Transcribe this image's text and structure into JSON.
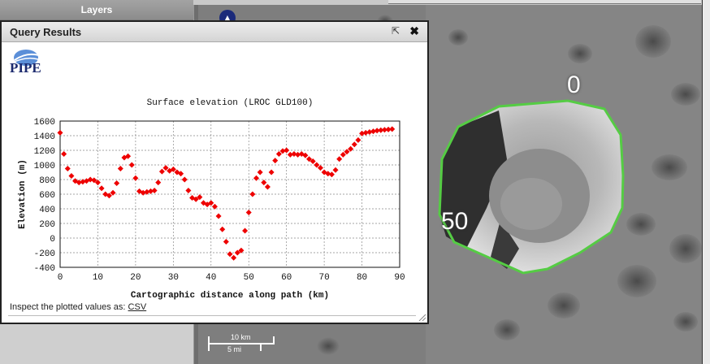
{
  "layers": {
    "title": "Layers"
  },
  "query_window": {
    "title": "Query Results",
    "popout_icon": "popout-icon",
    "close_icon": "close-icon",
    "logo_text": "PIPE",
    "inspect_text": "Inspect the plotted values as:",
    "csv_link": "CSV"
  },
  "map": {
    "path_label_start": "0",
    "path_label_mid": "50",
    "scale_km": "10 km",
    "scale_mi": "5 mi",
    "path_color": "#55cc44"
  },
  "chart_data": {
    "type": "scatter",
    "title": "Surface elevation (LROC GLD100)",
    "xlabel": "Cartographic distance along path (km)",
    "ylabel": "Elevation (m)",
    "xlim": [
      0,
      90
    ],
    "ylim": [
      -400,
      1600
    ],
    "xticks": [
      0,
      10,
      20,
      30,
      40,
      50,
      60,
      70,
      80,
      90
    ],
    "yticks": [
      -400,
      -200,
      0,
      200,
      400,
      600,
      800,
      1000,
      1200,
      1400,
      1600
    ],
    "grid": true,
    "marker_color": "#ee0000",
    "x": [
      0,
      1,
      2,
      3,
      4,
      5,
      6,
      7,
      8,
      9,
      10,
      11,
      12,
      13,
      14,
      15,
      16,
      17,
      18,
      19,
      20,
      21,
      22,
      23,
      24,
      25,
      26,
      27,
      28,
      29,
      30,
      31,
      32,
      33,
      34,
      35,
      36,
      37,
      38,
      39,
      40,
      41,
      42,
      43,
      44,
      45,
      46,
      47,
      48,
      49,
      50,
      51,
      52,
      53,
      54,
      55,
      56,
      57,
      58,
      59,
      60,
      61,
      62,
      63,
      64,
      65,
      66,
      67,
      68,
      69,
      70,
      71,
      72,
      73,
      74,
      75,
      76,
      77,
      78,
      79,
      80,
      81,
      82,
      83,
      84,
      85,
      86,
      87,
      88
    ],
    "y": [
      1440,
      1150,
      950,
      850,
      780,
      760,
      770,
      780,
      800,
      790,
      760,
      680,
      600,
      580,
      620,
      750,
      950,
      1100,
      1120,
      1000,
      820,
      640,
      620,
      630,
      640,
      650,
      760,
      910,
      960,
      920,
      940,
      900,
      880,
      800,
      650,
      550,
      530,
      560,
      480,
      460,
      480,
      430,
      300,
      120,
      -50,
      -220,
      -270,
      -200,
      -170,
      100,
      350,
      600,
      820,
      900,
      760,
      700,
      900,
      1060,
      1150,
      1190,
      1200,
      1140,
      1150,
      1140,
      1150,
      1130,
      1080,
      1050,
      1000,
      960,
      900,
      880,
      870,
      930,
      1080,
      1140,
      1180,
      1220,
      1280,
      1340,
      1430,
      1440,
      1450,
      1460,
      1470,
      1475,
      1480,
      1485,
      1490
    ]
  }
}
